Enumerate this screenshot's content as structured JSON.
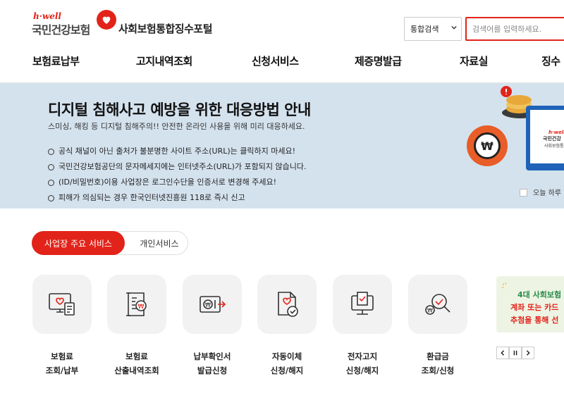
{
  "header": {
    "logo_small": "h·well",
    "logo_main": "국민건강보험",
    "portal_name": "사회보험통합징수포털"
  },
  "search": {
    "scope": "통합검색",
    "placeholder": "검색어를 입력하세요."
  },
  "gnb": [
    {
      "label": "보험료납부"
    },
    {
      "label": "고지내역조회"
    },
    {
      "label": "신청서비스"
    },
    {
      "label": "제증명발급"
    },
    {
      "label": "자료실"
    },
    {
      "label": "징수"
    }
  ],
  "banner": {
    "title": "디지털 침해사고 예방을 위한 대응방법 안내",
    "subtitle": "스미싱, 해킹 등 디지털 침해주의!! 안전한 온라인 사용을 위해 미리 대응하세요.",
    "items": [
      "공식 채널이 아닌 출처가 불분명한 사이트 주소(URL)는 클릭하지 마세요!",
      "국민건강보험공단의 문자메세지에는 인터넷주소(URL)가 포함되지 않습니다.",
      "(ID/비밀번호)이용 사업장은 로그인수단을 인증서로 변경해 주세요!",
      "피해가 의심되는 경우 한국인터넷진흥원 118로 즉시 신고"
    ],
    "won_symbol": "₩",
    "monitor_logo_small": "h·well",
    "monitor_logo_main": "국민건강",
    "monitor_logo_sub": "사회보험통",
    "today_label": "오늘 하루"
  },
  "tabs": {
    "active": "사업장 주요 서비스",
    "inactive": "개인서비스"
  },
  "services": [
    {
      "line1": "보험료",
      "line2": "조회/납부",
      "icon": "monitor-heart-icon"
    },
    {
      "line1": "보험료",
      "line2": "산출내역조회",
      "icon": "scroll-won-icon"
    },
    {
      "line1": "납부확인서",
      "line2": "발급신청",
      "icon": "card-won-icon"
    },
    {
      "line1": "자동이체",
      "line2": "신청/해지",
      "icon": "doc-check-icon"
    },
    {
      "line1": "전자고지",
      "line2": "신청/해지",
      "icon": "computer-check-icon"
    },
    {
      "line1": "환급금",
      "line2": "조회/신청",
      "icon": "search-won-icon"
    }
  ],
  "promo": {
    "line1": "4대 사회보험",
    "line2": "계좌 또는 카드",
    "line3": "추첨을 통해 선"
  },
  "colors": {
    "accent": "#e2231a",
    "banner_bg": "#d4e2ee"
  }
}
